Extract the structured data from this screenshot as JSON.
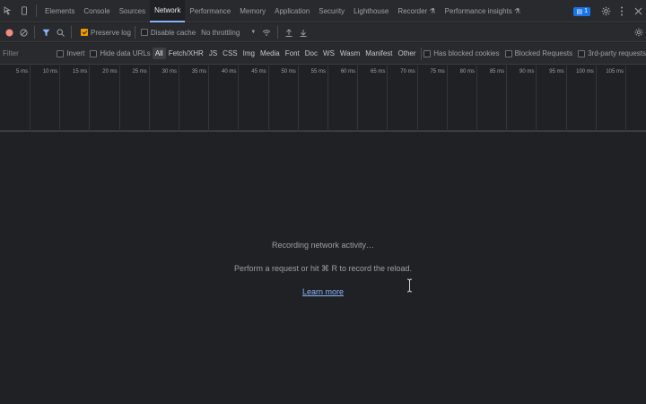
{
  "tabs": [
    {
      "label": "Elements"
    },
    {
      "label": "Console"
    },
    {
      "label": "Sources"
    },
    {
      "label": "Network",
      "active": true
    },
    {
      "label": "Performance"
    },
    {
      "label": "Memory"
    },
    {
      "label": "Application"
    },
    {
      "label": "Security"
    },
    {
      "label": "Lighthouse"
    },
    {
      "label": "Recorder ⚗"
    },
    {
      "label": "Performance insights ⚗"
    }
  ],
  "issues_badge": "1",
  "toolbar": {
    "preserve_log": "Preserve log",
    "disable_cache": "Disable cache",
    "throttling": "No throttling"
  },
  "filter": {
    "placeholder": "Filter",
    "invert": "Invert",
    "hide_data_urls": "Hide data URLs",
    "types": [
      "All",
      "Fetch/XHR",
      "JS",
      "CSS",
      "Img",
      "Media",
      "Font",
      "Doc",
      "WS",
      "Wasm",
      "Manifest",
      "Other"
    ],
    "has_blocked_cookies": "Has blocked cookies",
    "blocked_requests": "Blocked Requests",
    "third_party": "3rd-party requests"
  },
  "timeline_ticks": [
    "5 ms",
    "10 ms",
    "15 ms",
    "20 ms",
    "25 ms",
    "30 ms",
    "35 ms",
    "40 ms",
    "45 ms",
    "50 ms",
    "55 ms",
    "60 ms",
    "65 ms",
    "70 ms",
    "75 ms",
    "80 ms",
    "85 ms",
    "90 ms",
    "95 ms",
    "100 ms",
    "105 ms"
  ],
  "empty_state": {
    "recording": "Recording network activity…",
    "perform": "Perform a request or hit ⌘ R to record the reload.",
    "learn_more": "Learn more"
  },
  "colors": {
    "accent": "#8ab4f8",
    "record": "#f28b82",
    "preserve_checked": "#f29900",
    "filter_icon": "#8ab4f8"
  }
}
